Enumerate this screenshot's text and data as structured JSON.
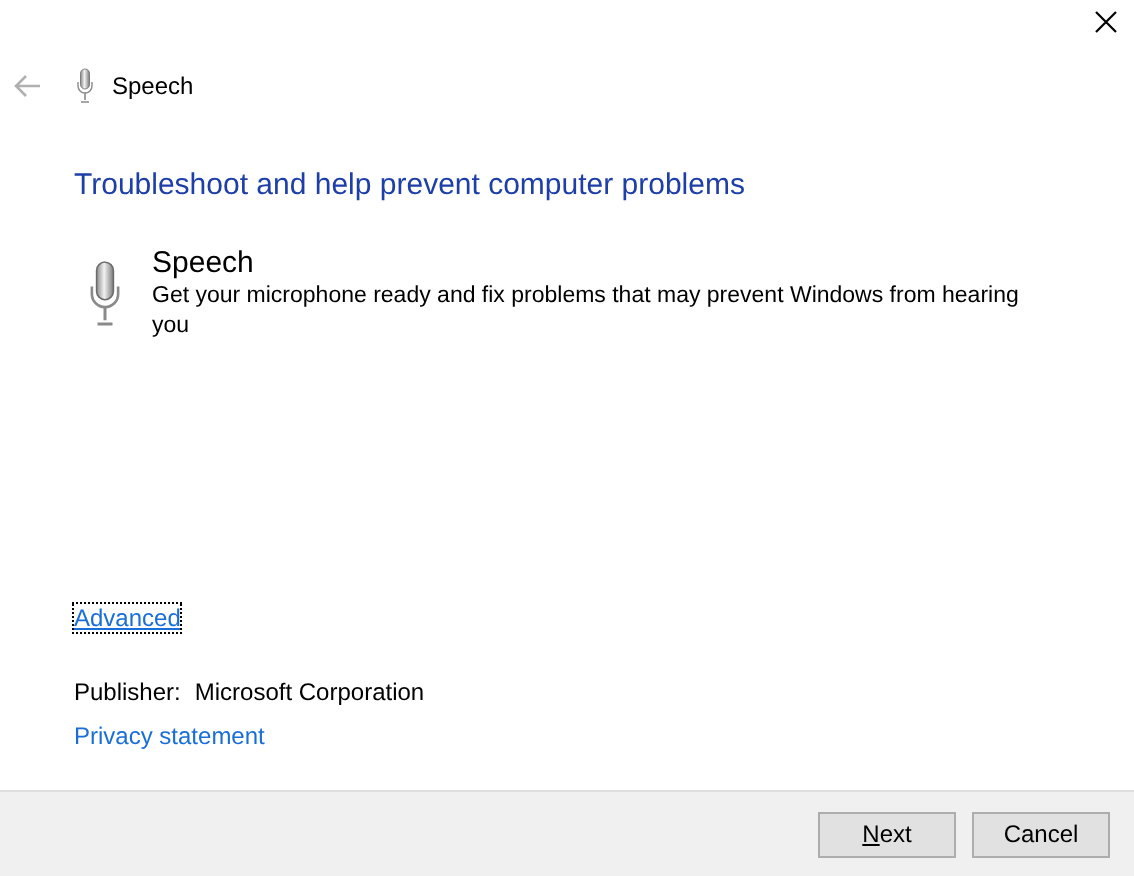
{
  "window": {
    "title": "Speech"
  },
  "heading": "Troubleshoot and help prevent computer problems",
  "troubleshooter": {
    "name": "Speech",
    "description": "Get your microphone ready and fix problems that may prevent Windows from hearing you"
  },
  "advanced_link": {
    "label": "Advanced",
    "focused": true
  },
  "publisher": {
    "label": "Publisher:",
    "value": "Microsoft Corporation"
  },
  "privacy_link": "Privacy statement",
  "buttons": [
    {
      "label": "Next",
      "first_letter_underlined": true
    },
    {
      "label": "Cancel"
    }
  ]
}
